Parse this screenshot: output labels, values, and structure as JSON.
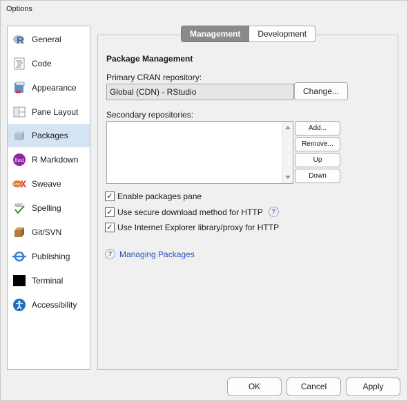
{
  "window": {
    "title": "Options"
  },
  "sidebar": {
    "items": [
      {
        "label": "General",
        "icon": "r-logo-icon"
      },
      {
        "label": "Code",
        "icon": "code-icon"
      },
      {
        "label": "Appearance",
        "icon": "appearance-icon"
      },
      {
        "label": "Pane Layout",
        "icon": "pane-layout-icon"
      },
      {
        "label": "Packages",
        "icon": "packages-icon",
        "active": true
      },
      {
        "label": "R Markdown",
        "icon": "rmarkdown-icon"
      },
      {
        "label": "Sweave",
        "icon": "sweave-icon"
      },
      {
        "label": "Spelling",
        "icon": "spelling-icon"
      },
      {
        "label": "Git/SVN",
        "icon": "git-icon"
      },
      {
        "label": "Publishing",
        "icon": "publishing-icon"
      },
      {
        "label": "Terminal",
        "icon": "terminal-icon"
      },
      {
        "label": "Accessibility",
        "icon": "accessibility-icon"
      }
    ]
  },
  "tabs": [
    {
      "label": "Management",
      "active": true
    },
    {
      "label": "Development",
      "active": false
    }
  ],
  "main": {
    "section_title": "Package Management",
    "primary_label": "Primary CRAN repository:",
    "primary_value": "Global (CDN) - RStudio",
    "change_button": "Change...",
    "secondary_label": "Secondary repositories:",
    "repo_buttons": {
      "add": "Add...",
      "remove": "Remove...",
      "up": "Up",
      "down": "Down"
    },
    "checkboxes": [
      {
        "label": "Enable packages pane",
        "checked": true
      },
      {
        "label": "Use secure download method for HTTP",
        "checked": true,
        "help": true
      },
      {
        "label": "Use Internet Explorer library/proxy for HTTP",
        "checked": true
      }
    ],
    "help_link": "Managing Packages",
    "check_mark": "✓",
    "help_mark": "?"
  },
  "footer": {
    "ok": "OK",
    "cancel": "Cancel",
    "apply": "Apply"
  },
  "colors": {
    "active_nav": "#d5e4f5",
    "link": "#2a4dbf",
    "tab_active": "#8a8a8a"
  }
}
